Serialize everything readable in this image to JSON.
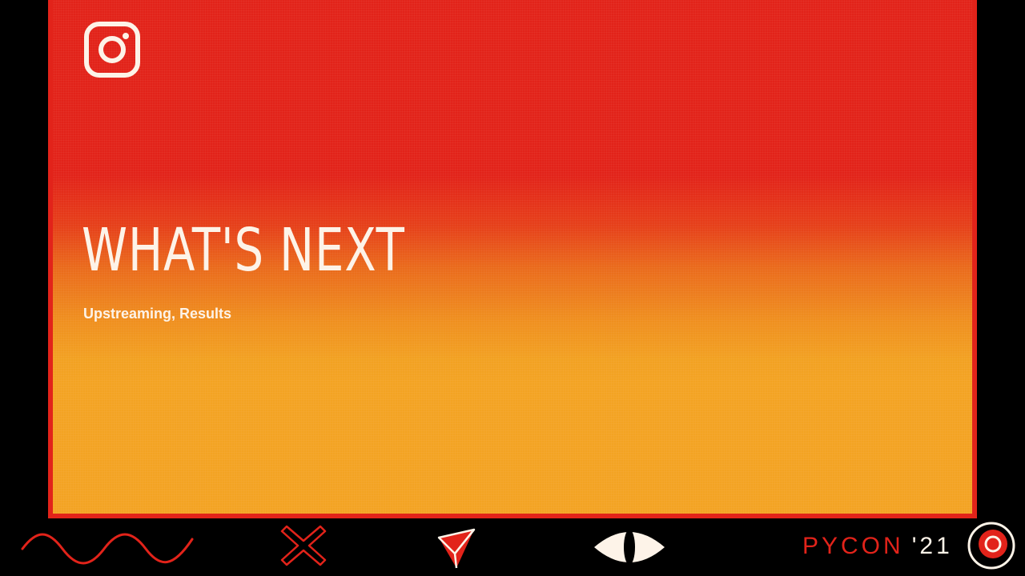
{
  "slide": {
    "title": "WHAT'S NEXT",
    "subtitle": "Upstreaming, Results",
    "logo_icon": "instagram-icon"
  },
  "footer": {
    "icons": [
      "wave-icon",
      "cross-icon",
      "triangle-icon",
      "eye-icon",
      "pycon-circle-icon"
    ],
    "brand_name": "PYCON",
    "brand_year": "'21"
  },
  "colors": {
    "red": "#e2231a",
    "orange": "#f3a323",
    "cream": "#fdf3e8",
    "background": "#000000"
  }
}
